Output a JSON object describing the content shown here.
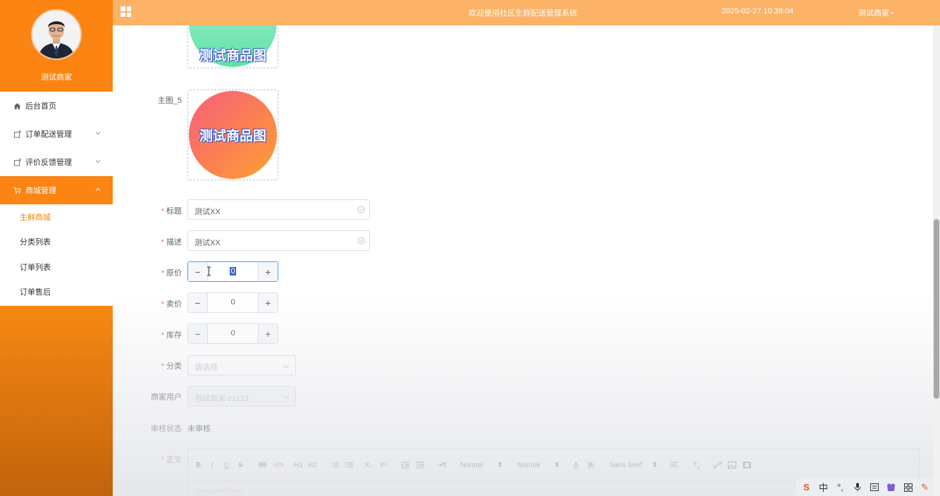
{
  "sidebar": {
    "profile_name": "测试商家",
    "menu": [
      {
        "label": "后台首页",
        "icon": "home-icon"
      },
      {
        "label": "订单配送管理",
        "icon": "box-icon"
      },
      {
        "label": "评价反馈管理",
        "icon": "box-icon"
      },
      {
        "label": "商城管理",
        "icon": "cart-icon"
      }
    ],
    "submenu": [
      "生鲜商城",
      "分类列表",
      "订单列表",
      "订单售后"
    ]
  },
  "topbar": {
    "title": "欢迎使用社区生鲜配送管理系统",
    "datetime": "2025-02-27 10:39:04",
    "user": "测试商家"
  },
  "form": {
    "image_label": "主图_5",
    "image_text": "测试商品图",
    "title_label": "标题",
    "title_value": "测试XX",
    "desc_label": "描述",
    "desc_value": "测试XX",
    "orig_price_label": "原价",
    "orig_price_value": "0",
    "sale_price_label": "卖价",
    "sale_price_value": "0",
    "stock_label": "库存",
    "stock_value": "0",
    "category_label": "分类",
    "category_placeholder": "请选择",
    "merchant_label": "商家用户",
    "merchant_value": "测试商家-zz123",
    "status_label": "审核状态",
    "status_value": "未审核",
    "body_label": "正文",
    "editor_placeholder": "Insert text here ...",
    "editor_toolbar": {
      "bold": "B",
      "italic": "I",
      "underline": "U",
      "strike": "S",
      "quote": "99",
      "code": "</>",
      "h1": "H1",
      "h2": "H2",
      "sub": "X₂",
      "sup": "X²",
      "size_select": "Normal",
      "header_select": "Normal",
      "font_select": "Sans Serif"
    }
  },
  "colors": {
    "accent": "#fb8413",
    "topbar": "#fcb267",
    "required": "#f56c6c",
    "focus": "#409eff"
  }
}
